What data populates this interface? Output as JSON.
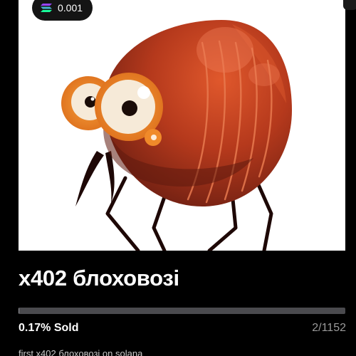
{
  "token": {
    "price": "0.001",
    "currency_icon": "solana-icon",
    "title": "x402 блоховозі",
    "sold_label": "0.17% Sold",
    "sold_fraction": 0.0017,
    "count": "2/1152",
    "description": "first x402 блоховозі on solana"
  },
  "colors": {
    "background": "#000000",
    "art_background": "#ffffff",
    "progress_track": "#4a4a4e",
    "progress_fill": "#9a9aa0",
    "bug_body": "#b0361c",
    "bug_eye": "#f08a2a"
  }
}
